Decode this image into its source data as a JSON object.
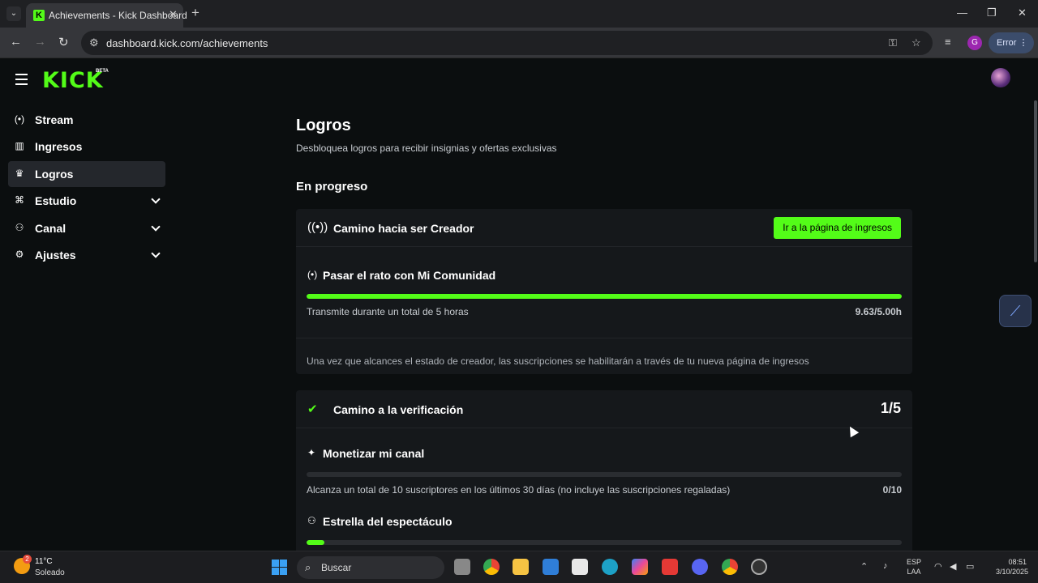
{
  "browser": {
    "tab_title": "Achievements - Kick Dashboard",
    "url": "dashboard.kick.com/achievements",
    "profile_initial": "G",
    "error_label": "Error"
  },
  "app": {
    "logo": "KICK",
    "logo_badge": "BETA"
  },
  "sidebar": {
    "items": [
      {
        "label": "Stream",
        "icon": "broadcast-icon",
        "active": false,
        "expandable": false
      },
      {
        "label": "Ingresos",
        "icon": "chart-icon",
        "active": false,
        "expandable": false
      },
      {
        "label": "Logros",
        "icon": "trophy-icon",
        "active": true,
        "expandable": false
      },
      {
        "label": "Estudio",
        "icon": "studio-icon",
        "active": false,
        "expandable": true
      },
      {
        "label": "Canal",
        "icon": "channel-icon",
        "active": false,
        "expandable": true
      },
      {
        "label": "Ajustes",
        "icon": "gear-icon",
        "active": false,
        "expandable": true
      }
    ]
  },
  "main": {
    "title": "Logros",
    "subtitle": "Desbloquea logros para recibir insignias y ofertas exclusivas",
    "section": "En progreso",
    "cards": [
      {
        "title": "Camino hacia ser Creador",
        "cta": "Ir a la página de ingresos",
        "tasks": [
          {
            "title": "Pasar el rato con Mi Comunidad",
            "desc": "Transmite durante un total de 5 horas",
            "value": "9.63/5.00h",
            "progress": 1.0
          }
        ],
        "note": "Una vez que alcances el estado de creador, las suscripciones se habilitarán a través de tu nueva página de ingresos"
      },
      {
        "title": "Camino a la verificación",
        "fraction": "1/5",
        "tasks": [
          {
            "title": "Monetizar mi canal",
            "desc": "Alcanza un total de 10 suscriptores en los últimos 30 días (no incluye las suscripciones regaladas)",
            "value": "0/10",
            "progress": 0.0
          },
          {
            "title": "Estrella del espectáculo",
            "progress": 0.03
          }
        ]
      }
    ]
  },
  "taskbar": {
    "temp": "11°C",
    "condition": "Soleado",
    "weather_badge": "2",
    "search": "Buscar",
    "lang_line1": "ESP",
    "lang_line2": "LAA",
    "time": "08:51",
    "date": "3/10/2025"
  },
  "colors": {
    "accent": "#53fc18",
    "background": "#0b0e0f",
    "card": "#15181b"
  }
}
